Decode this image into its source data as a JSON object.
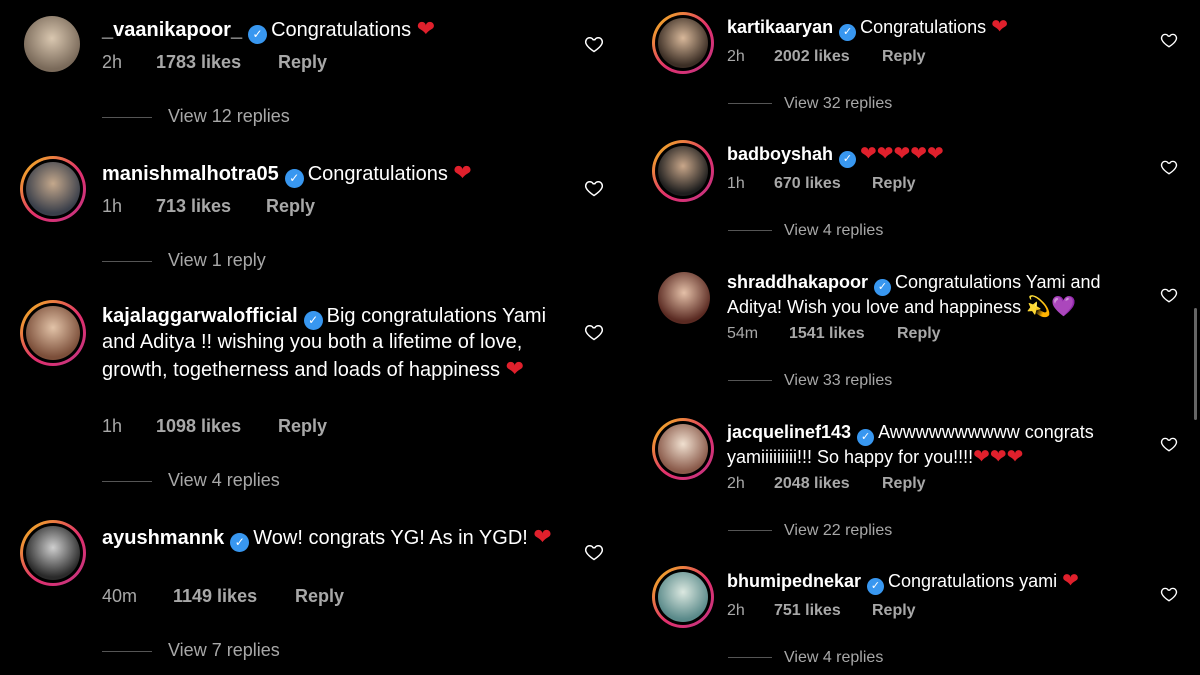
{
  "left": [
    {
      "user": "_vaanikapoor_",
      "text": "Congratulations",
      "hearts": "❤",
      "time": "2h",
      "likes": "1783 likes",
      "reply": "Reply",
      "view": "View 12 replies"
    },
    {
      "user": "manishmalhotra05",
      "text": "Congratulations",
      "hearts": "❤",
      "time": "1h",
      "likes": "713 likes",
      "reply": "Reply",
      "view": "View 1 reply"
    },
    {
      "user": "kajalaggarwalofficial",
      "text": "Big congratulations Yami and Aditya !! wishing you both a lifetime of love, growth, togetherness and loads of happiness",
      "hearts": "❤",
      "time": "1h",
      "likes": "1098 likes",
      "reply": "Reply",
      "view": "View 4 replies"
    },
    {
      "user": "ayushmannk",
      "text": "Wow! congrats YG! As in YGD!",
      "hearts": "❤",
      "time": "40m",
      "likes": "1149 likes",
      "reply": "Reply",
      "view": "View 7 replies"
    }
  ],
  "right": [
    {
      "user": "kartikaaryan",
      "text": "Congratulations",
      "hearts": "❤",
      "time": "2h",
      "likes": "2002 likes",
      "reply": "Reply",
      "view": "View 32 replies"
    },
    {
      "user": "badboyshah",
      "text": "",
      "hearts": "❤❤❤❤❤",
      "time": "1h",
      "likes": "670 likes",
      "reply": "Reply",
      "view": "View 4 replies"
    },
    {
      "user": "shraddhakapoor",
      "text": "Congratulations Yami and Aditya! Wish you love and happiness",
      "hearts": "💫💜",
      "time": "54m",
      "likes": "1541 likes",
      "reply": "Reply",
      "view": "View 33 replies"
    },
    {
      "user": "jacquelinef143",
      "text": "Awwwwwwwwww congrats yamiiiiiiiii!!! So happy for you!!!!",
      "hearts": "❤❤❤",
      "time": "2h",
      "likes": "2048 likes",
      "reply": "Reply",
      "view": "View 22 replies"
    },
    {
      "user": "bhumipednekar",
      "text": "Congratulations yami",
      "hearts": "❤",
      "time": "2h",
      "likes": "751 likes",
      "reply": "Reply",
      "view": "View 4 replies"
    }
  ],
  "icons": {
    "verified": "verified-badge-icon",
    "like": "heart-outline-icon"
  },
  "colors": {
    "background": "#000000",
    "verified": "#3897f0",
    "heart": "#e0202c",
    "muted": "#a8a8a8"
  }
}
